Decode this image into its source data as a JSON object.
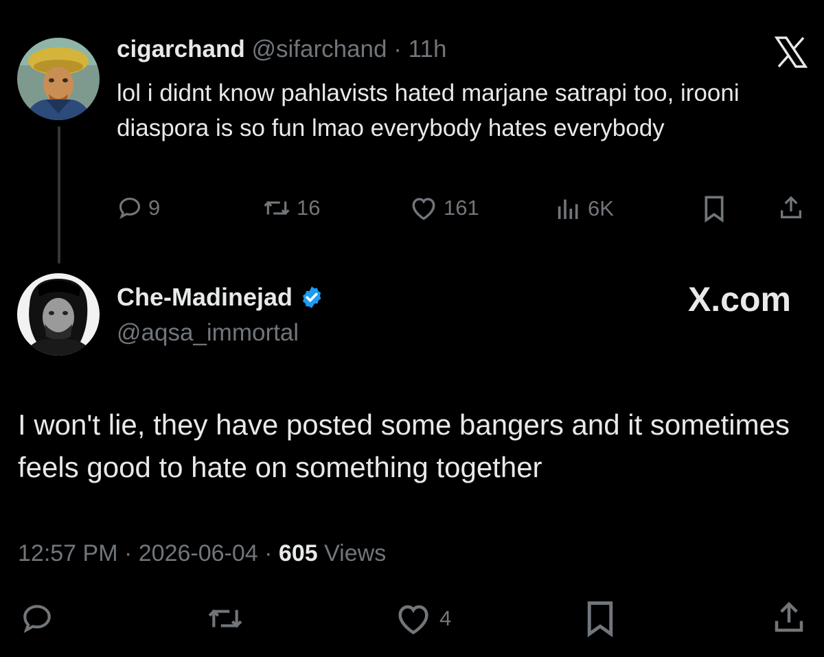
{
  "parent": {
    "name": "cigarchand",
    "handle": "@sifarchand",
    "separator": "·",
    "time": "11h",
    "text": "lol i didnt know pahlavists hated marjane satrapi too, irooni diaspora is so fun lmao everybody hates everybody",
    "replies": "9",
    "reposts": "16",
    "likes": "161",
    "views": "6K"
  },
  "reply": {
    "name": "Che-Madinejad",
    "handle": "@aqsa_immortal",
    "text": "I won't lie, they have posted some bangers and it sometimes feels good to hate on something together",
    "time": "12:57 PM",
    "date": "2026-06-04",
    "separator": "·",
    "views_count": "605",
    "views_label": "Views",
    "likes": "4"
  },
  "watermark": {
    "logo": "x-logo-icon",
    "site": "X.com"
  },
  "colors": {
    "background": "#000000",
    "text": "#e7e9ea",
    "muted": "#71767b",
    "verified": "#1d9bf0"
  }
}
